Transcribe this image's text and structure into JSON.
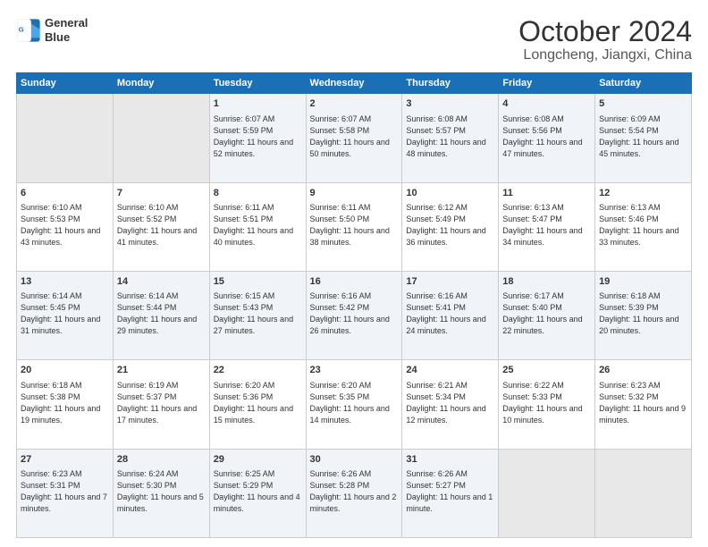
{
  "logo": {
    "line1": "General",
    "line2": "Blue"
  },
  "title": "October 2024",
  "subtitle": "Longcheng, Jiangxi, China",
  "weekdays": [
    "Sunday",
    "Monday",
    "Tuesday",
    "Wednesday",
    "Thursday",
    "Friday",
    "Saturday"
  ],
  "weeks": [
    [
      {
        "day": "",
        "info": ""
      },
      {
        "day": "",
        "info": ""
      },
      {
        "day": "1",
        "info": "Sunrise: 6:07 AM\nSunset: 5:59 PM\nDaylight: 11 hours and 52 minutes."
      },
      {
        "day": "2",
        "info": "Sunrise: 6:07 AM\nSunset: 5:58 PM\nDaylight: 11 hours and 50 minutes."
      },
      {
        "day": "3",
        "info": "Sunrise: 6:08 AM\nSunset: 5:57 PM\nDaylight: 11 hours and 48 minutes."
      },
      {
        "day": "4",
        "info": "Sunrise: 6:08 AM\nSunset: 5:56 PM\nDaylight: 11 hours and 47 minutes."
      },
      {
        "day": "5",
        "info": "Sunrise: 6:09 AM\nSunset: 5:54 PM\nDaylight: 11 hours and 45 minutes."
      }
    ],
    [
      {
        "day": "6",
        "info": "Sunrise: 6:10 AM\nSunset: 5:53 PM\nDaylight: 11 hours and 43 minutes."
      },
      {
        "day": "7",
        "info": "Sunrise: 6:10 AM\nSunset: 5:52 PM\nDaylight: 11 hours and 41 minutes."
      },
      {
        "day": "8",
        "info": "Sunrise: 6:11 AM\nSunset: 5:51 PM\nDaylight: 11 hours and 40 minutes."
      },
      {
        "day": "9",
        "info": "Sunrise: 6:11 AM\nSunset: 5:50 PM\nDaylight: 11 hours and 38 minutes."
      },
      {
        "day": "10",
        "info": "Sunrise: 6:12 AM\nSunset: 5:49 PM\nDaylight: 11 hours and 36 minutes."
      },
      {
        "day": "11",
        "info": "Sunrise: 6:13 AM\nSunset: 5:47 PM\nDaylight: 11 hours and 34 minutes."
      },
      {
        "day": "12",
        "info": "Sunrise: 6:13 AM\nSunset: 5:46 PM\nDaylight: 11 hours and 33 minutes."
      }
    ],
    [
      {
        "day": "13",
        "info": "Sunrise: 6:14 AM\nSunset: 5:45 PM\nDaylight: 11 hours and 31 minutes."
      },
      {
        "day": "14",
        "info": "Sunrise: 6:14 AM\nSunset: 5:44 PM\nDaylight: 11 hours and 29 minutes."
      },
      {
        "day": "15",
        "info": "Sunrise: 6:15 AM\nSunset: 5:43 PM\nDaylight: 11 hours and 27 minutes."
      },
      {
        "day": "16",
        "info": "Sunrise: 6:16 AM\nSunset: 5:42 PM\nDaylight: 11 hours and 26 minutes."
      },
      {
        "day": "17",
        "info": "Sunrise: 6:16 AM\nSunset: 5:41 PM\nDaylight: 11 hours and 24 minutes."
      },
      {
        "day": "18",
        "info": "Sunrise: 6:17 AM\nSunset: 5:40 PM\nDaylight: 11 hours and 22 minutes."
      },
      {
        "day": "19",
        "info": "Sunrise: 6:18 AM\nSunset: 5:39 PM\nDaylight: 11 hours and 20 minutes."
      }
    ],
    [
      {
        "day": "20",
        "info": "Sunrise: 6:18 AM\nSunset: 5:38 PM\nDaylight: 11 hours and 19 minutes."
      },
      {
        "day": "21",
        "info": "Sunrise: 6:19 AM\nSunset: 5:37 PM\nDaylight: 11 hours and 17 minutes."
      },
      {
        "day": "22",
        "info": "Sunrise: 6:20 AM\nSunset: 5:36 PM\nDaylight: 11 hours and 15 minutes."
      },
      {
        "day": "23",
        "info": "Sunrise: 6:20 AM\nSunset: 5:35 PM\nDaylight: 11 hours and 14 minutes."
      },
      {
        "day": "24",
        "info": "Sunrise: 6:21 AM\nSunset: 5:34 PM\nDaylight: 11 hours and 12 minutes."
      },
      {
        "day": "25",
        "info": "Sunrise: 6:22 AM\nSunset: 5:33 PM\nDaylight: 11 hours and 10 minutes."
      },
      {
        "day": "26",
        "info": "Sunrise: 6:23 AM\nSunset: 5:32 PM\nDaylight: 11 hours and 9 minutes."
      }
    ],
    [
      {
        "day": "27",
        "info": "Sunrise: 6:23 AM\nSunset: 5:31 PM\nDaylight: 11 hours and 7 minutes."
      },
      {
        "day": "28",
        "info": "Sunrise: 6:24 AM\nSunset: 5:30 PM\nDaylight: 11 hours and 5 minutes."
      },
      {
        "day": "29",
        "info": "Sunrise: 6:25 AM\nSunset: 5:29 PM\nDaylight: 11 hours and 4 minutes."
      },
      {
        "day": "30",
        "info": "Sunrise: 6:26 AM\nSunset: 5:28 PM\nDaylight: 11 hours and 2 minutes."
      },
      {
        "day": "31",
        "info": "Sunrise: 6:26 AM\nSunset: 5:27 PM\nDaylight: 11 hours and 1 minute."
      },
      {
        "day": "",
        "info": ""
      },
      {
        "day": "",
        "info": ""
      }
    ]
  ]
}
